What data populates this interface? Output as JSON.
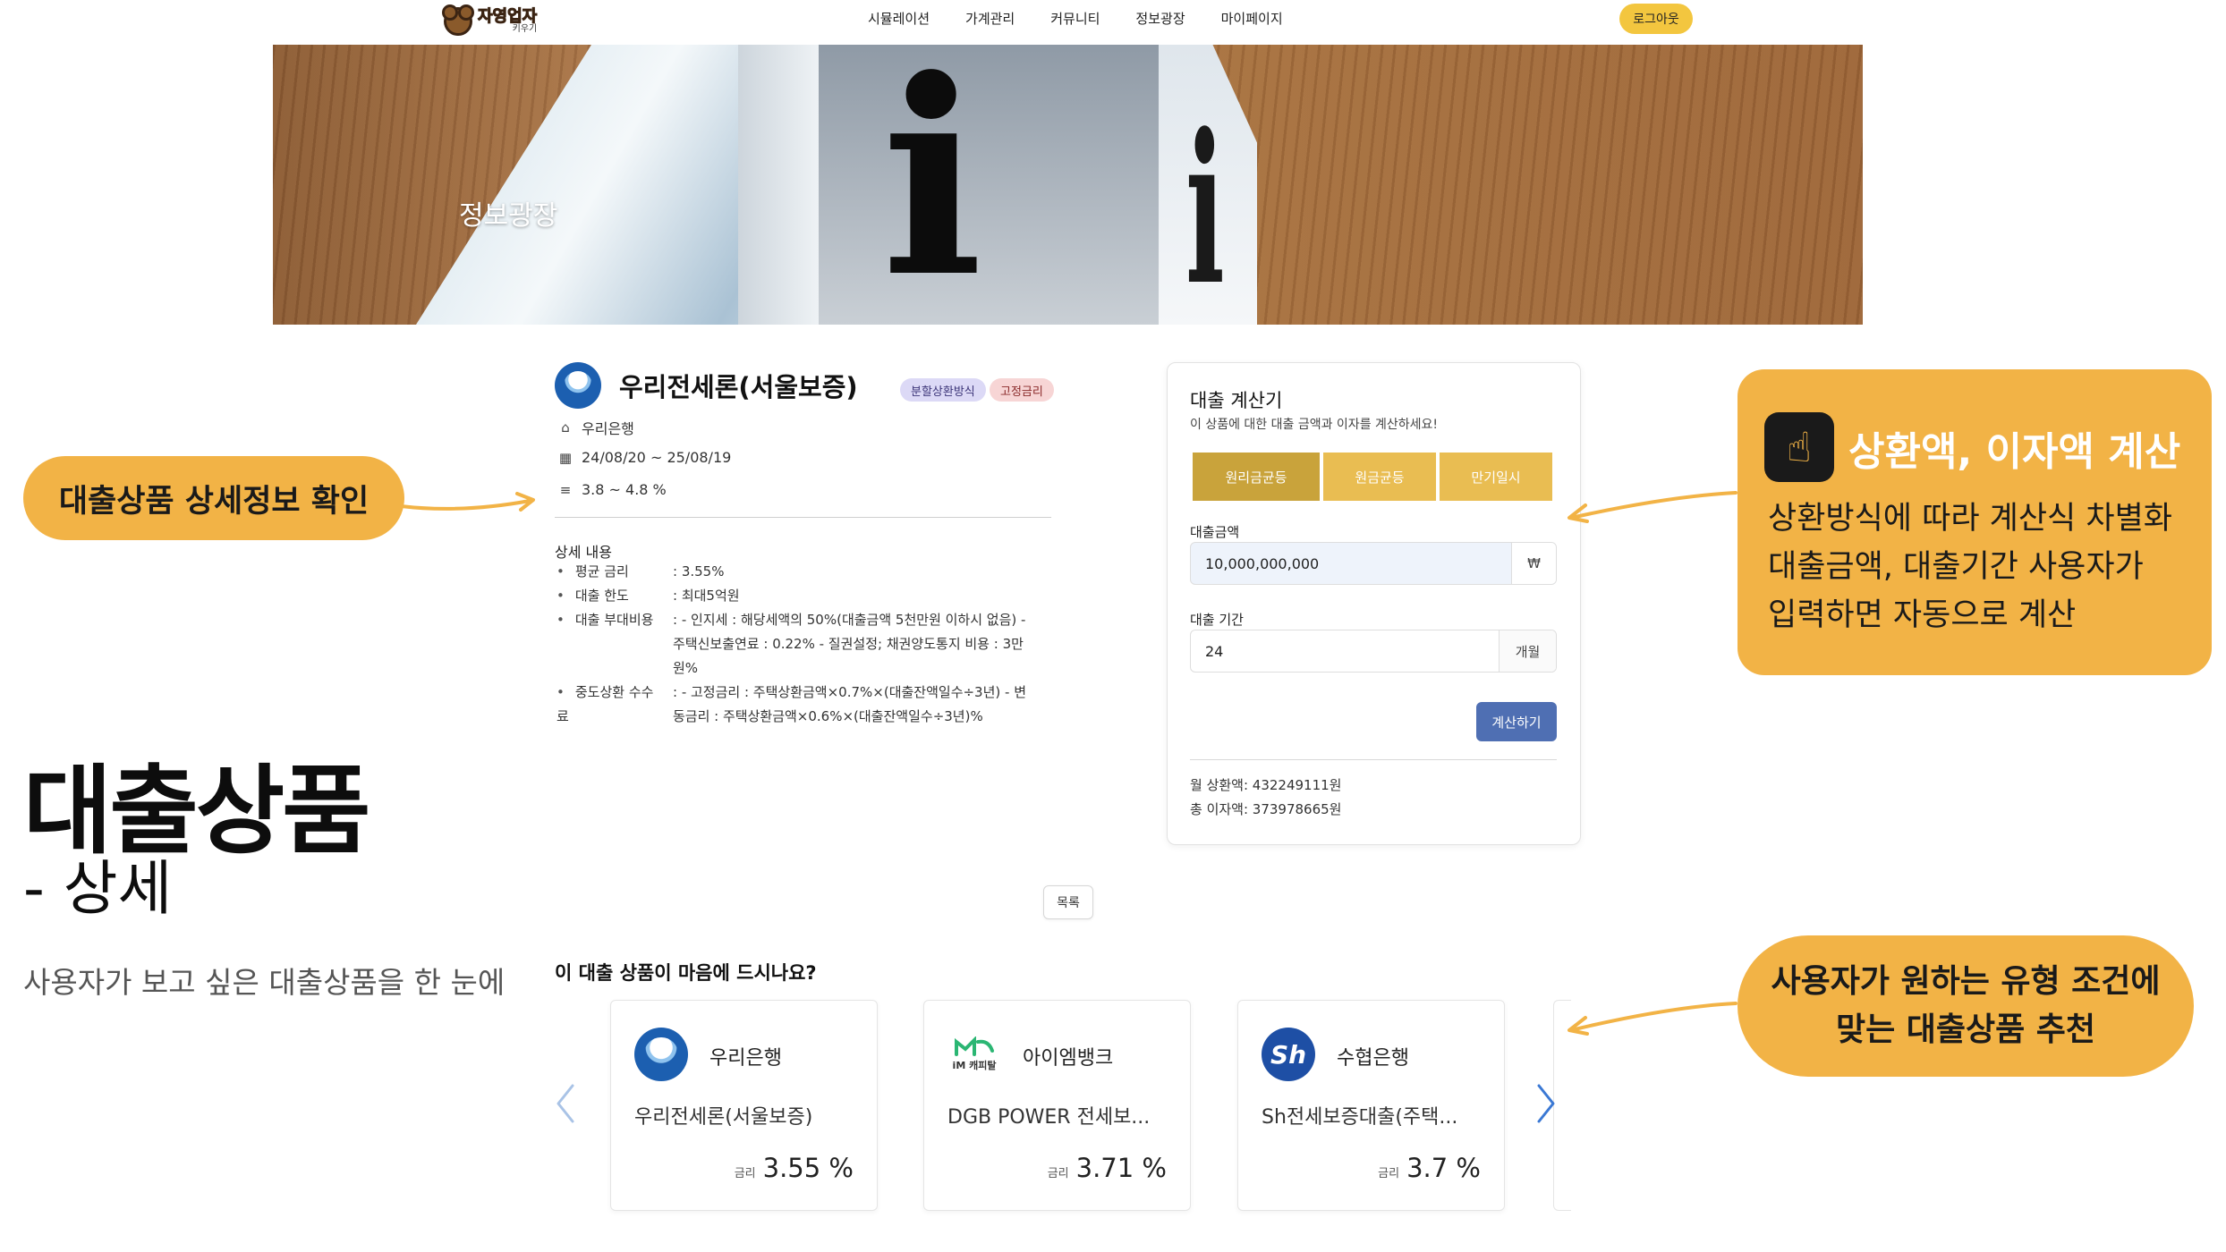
{
  "header": {
    "logo": {
      "main": "자영업자",
      "sub": "키우기"
    },
    "nav": [
      "시뮬레이션",
      "가계관리",
      "커뮤니티",
      "정보광장",
      "마이페이지"
    ],
    "logout_label": "로그아웃"
  },
  "banner": {
    "title": "정보광장"
  },
  "slide": {
    "callout_left": "대출상품 상세정보 확인",
    "title": "대출상품",
    "subtitle": "- 상세",
    "description": "사용자가 보고 싶은 대출상품을 한 눈에"
  },
  "product": {
    "name": "우리전세론(서울보증)",
    "tags": [
      "분할상환방식",
      "고정금리"
    ],
    "bank": "우리은행",
    "period": "24/08/20 ~ 25/08/19",
    "rate_range": "3.8 ~ 4.8 %",
    "detail_heading": "상세 내용",
    "details": [
      {
        "key": "평균 금리",
        "value": ": 3.55%"
      },
      {
        "key": "대출 한도",
        "value": ": 최대5억원"
      },
      {
        "key": "대출 부대비용",
        "value": ": - 인지세 : 해당세액의 50%(대출금액 5천만원 이하시 없음) - 주택신보출연료 : 0.22% - 질권설정; 채권양도통지 비용 : 3만원%"
      },
      {
        "key": "중도상환 수수료",
        "value": ": - 고정금리 : 주택상환금액×0.7%×(대출잔액일수÷3년) - 변동금리 : 주택상환금액×0.6%×(대출잔액일수÷3년)%"
      }
    ]
  },
  "calculator": {
    "title": "대출 계산기",
    "description": "이 상품에 대한 대출 금액과 이자를 계산하세요!",
    "methods": [
      "원리금균등",
      "원금균등",
      "만기일시"
    ],
    "amount_label": "대출금액",
    "amount_value": "10,000,000,000",
    "amount_unit": "₩",
    "period_label": "대출 기간",
    "period_value": "24",
    "period_unit": "개월",
    "button_label": "계산하기",
    "monthly_result": "월 상환액: 432249111원",
    "interest_result": "총 이자액: 373978665원"
  },
  "list_button": "목록",
  "recommend": {
    "title": "이 대출 상품이 마음에 드시나요?",
    "rate_label": "금리",
    "cards": [
      {
        "bank": "우리은행",
        "product": "우리전세론(서울보증)",
        "rate": "3.55 %",
        "logo": "woori-logo"
      },
      {
        "bank": "아이엠뱅크",
        "product": "DGB POWER 전세보...",
        "rate": "3.71 %",
        "logo": "im-bank-logo",
        "logo_text": "iM 캐피탈"
      },
      {
        "bank": "수협은행",
        "product": "Sh전세보증대출(주택...",
        "rate": "3.7 %",
        "logo": "suhyup-logo",
        "logo_text": "Sh"
      }
    ]
  },
  "callouts_right": {
    "calc_title": "상환액, 이자액 계산",
    "calc_body": [
      "상환방식에 따라 계산식 차별화",
      "대출금액, 대출기간 사용자가",
      "입력하면 자동으로 계산"
    ],
    "recommend_body": [
      "사용자가 원하는 유형 조건에",
      "맞는 대출상품 추천"
    ]
  },
  "colors": {
    "accent": "#f2b346",
    "segment_active": "#c9a33b",
    "segment": "#e9bd52",
    "button": "#4f6fb3"
  }
}
